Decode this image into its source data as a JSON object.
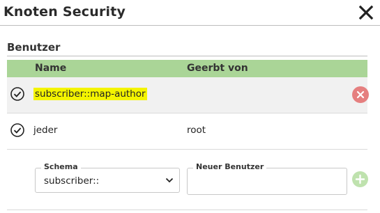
{
  "dialog": {
    "title": "Knoten Security"
  },
  "users_section": {
    "title": "Benutzer",
    "columns": {
      "name": "Name",
      "inherited_from": "Geerbt von"
    },
    "rows": [
      {
        "name": "subscriber::map-author",
        "inherited_from": "",
        "highlighted": true
      },
      {
        "name": "jeder",
        "inherited_from": "root",
        "highlighted": false
      }
    ],
    "add_form": {
      "schema_label": "Schema",
      "schema_value": "subscriber::",
      "new_user_label": "Neuer Benutzer",
      "new_user_value": ""
    }
  },
  "colors": {
    "header_green": "#aad597",
    "highlight_yellow": "#f4f400",
    "remove_red": "#e57f7f",
    "add_green": "#bfe2ae"
  }
}
